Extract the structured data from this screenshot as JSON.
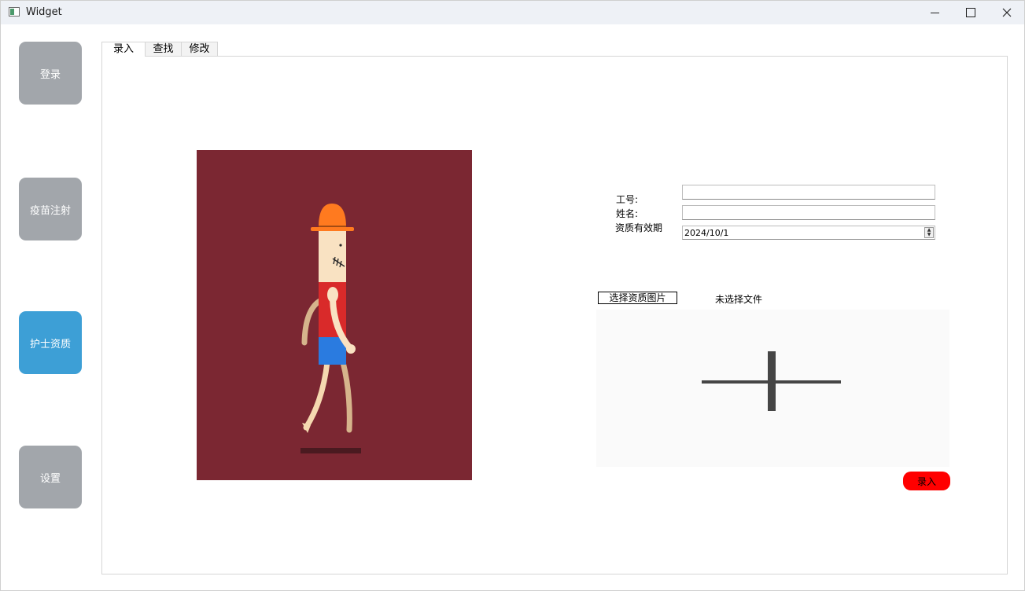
{
  "window": {
    "title": "Widget"
  },
  "sidebar": {
    "items": [
      {
        "label": "登录",
        "active": false
      },
      {
        "label": "疫苗注射",
        "active": false
      },
      {
        "label": "护士资质",
        "active": true
      },
      {
        "label": "设置",
        "active": false
      }
    ]
  },
  "tabs": [
    {
      "label": "录入",
      "active": true
    },
    {
      "label": "查找",
      "active": false
    },
    {
      "label": "修改",
      "active": false
    }
  ],
  "form": {
    "id_label": "工号:",
    "id_value": "",
    "name_label": "姓名:",
    "name_value": "",
    "validity_label": "资质有效期",
    "validity_value": "2024/10/1",
    "choose_image_label": "选择资质图片",
    "file_status": "未选择文件",
    "submit_label": "录入"
  },
  "colors": {
    "sidebar_button": "#a2a6ab",
    "sidebar_button_active": "#3d9fd6",
    "animation_background": "#7b2732",
    "submit_button": "#ff0000"
  },
  "icons": {
    "preview_placeholder": "plus-icon"
  }
}
